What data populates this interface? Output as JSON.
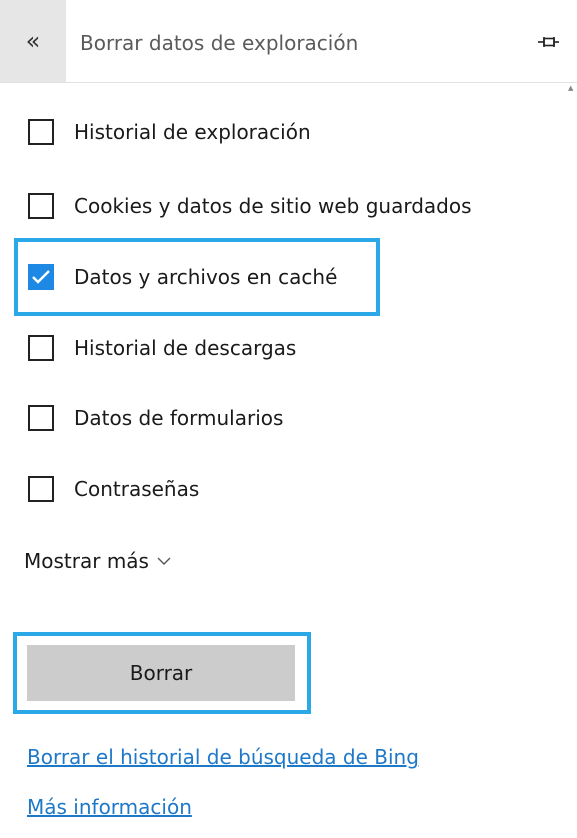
{
  "header": {
    "back_icon": "«",
    "title": "Borrar datos de exploración",
    "pin_icon": "pin-icon"
  },
  "options": [
    {
      "label": "Historial de exploración",
      "checked": false
    },
    {
      "label": "Cookies y datos de sitio web guardados",
      "checked": false
    },
    {
      "label": "Datos y archivos en caché",
      "checked": true
    },
    {
      "label": "Historial de descargas",
      "checked": false
    },
    {
      "label": "Datos de formularios",
      "checked": false
    },
    {
      "label": "Contraseñas",
      "checked": false
    }
  ],
  "show_more": {
    "label": "Mostrar más",
    "icon": "chevron-down-icon"
  },
  "clear_button": {
    "label": "Borrar"
  },
  "links": {
    "bing_history": "Borrar el historial de búsqueda de Bing",
    "more_info": "Más información"
  },
  "colors": {
    "accent": "#1e88e5",
    "highlight": "#2aa8e8",
    "link": "#1e78c8",
    "button_bg": "#cccccc",
    "back_bg": "#e6e6e6"
  }
}
